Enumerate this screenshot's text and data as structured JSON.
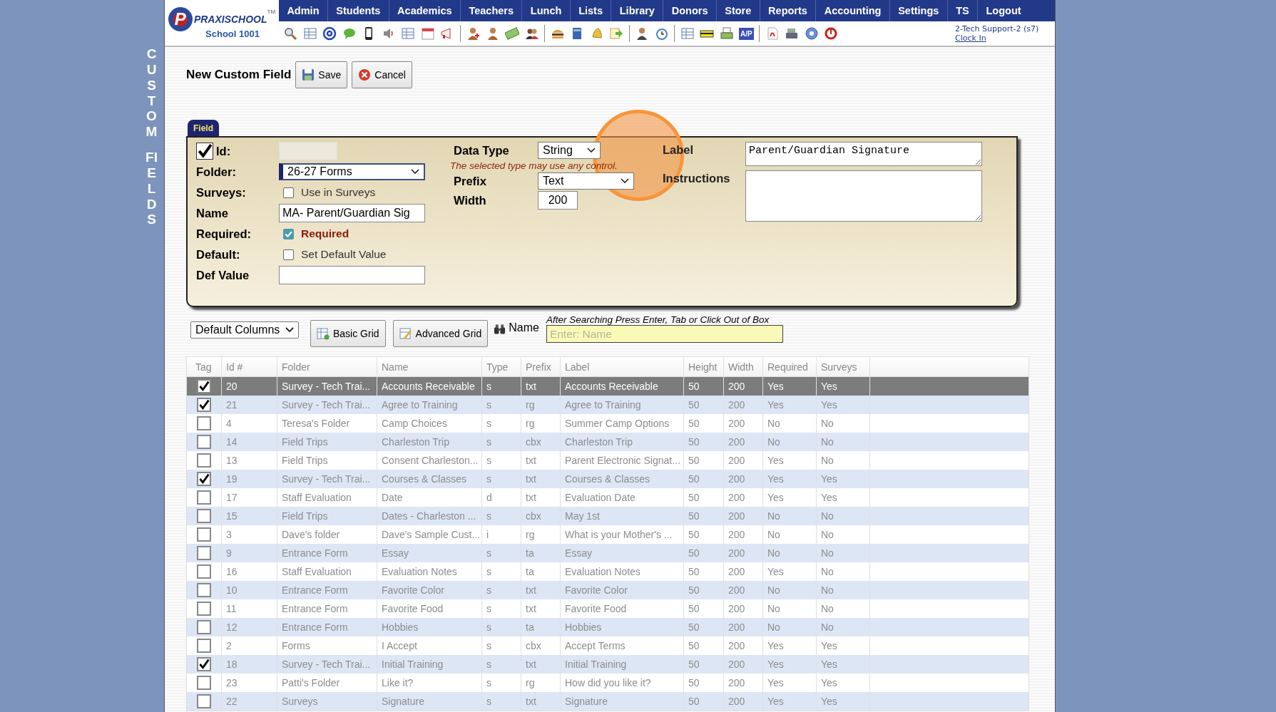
{
  "side_title": [
    "CUSTOM",
    "FIELDS"
  ],
  "logo": {
    "mark": "P",
    "name": "PRAXISCHOOL",
    "tm": "TM",
    "school": "School 1001"
  },
  "nav": [
    "Admin",
    "Students",
    "Academics",
    "Teachers",
    "Lunch",
    "Lists",
    "Library",
    "Donors",
    "Store",
    "Reports",
    "Accounting",
    "Settings",
    "TS",
    "Logout"
  ],
  "toolbar": {
    "ap_badge": "A/P"
  },
  "user": {
    "name": "2-Tech Support-2 (s7)",
    "clock_link": "Clock In"
  },
  "page_title": "New Custom Field",
  "actions": [
    "Save",
    "Cancel"
  ],
  "form": {
    "tab": "Field",
    "id": {
      "label": "Id:",
      "checked": true
    },
    "folder": {
      "label": "Folder:",
      "value": "26-27 Forms"
    },
    "surveys": {
      "label": "Surveys:",
      "option": "Use in Surveys",
      "checked": false
    },
    "name": {
      "label": "Name",
      "value": "MA- Parent/Guardian Sig"
    },
    "required": {
      "label": "Required:",
      "option": "Required",
      "checked": true
    },
    "default": {
      "label": "Default:",
      "option": "Set Default Value",
      "checked": false
    },
    "def_value": {
      "label": "Def Value"
    },
    "data_type": {
      "label": "Data Type",
      "value": "String",
      "hint": "The selected type may use any control."
    },
    "prefix": {
      "label": "Prefix",
      "value": "Text"
    },
    "width": {
      "label": "Width",
      "value": "200"
    },
    "label": {
      "label": "Label",
      "value": "Parent/Guardian Signature"
    },
    "instructions": {
      "label": "Instructions"
    }
  },
  "grid_toolbar": {
    "columns_select": "Default Columns",
    "buttons": [
      "Basic Grid",
      "Advanced Grid"
    ],
    "search_label": "Name",
    "search_hint": "After Searching Press Enter, Tab or Click Out of Box",
    "placeholder": "Enter: Name"
  },
  "table": {
    "tag_column": "Tag",
    "columns": [
      "Id #",
      "Folder",
      "Name",
      "Type",
      "Prefix",
      "Label",
      "Height",
      "Width",
      "Required",
      "Surveys"
    ],
    "rows": [
      {
        "tag": true,
        "selected": true,
        "cells": [
          "20",
          "Survey - Tech Trai...",
          "Accounts Receivable",
          "s",
          "txt",
          "Accounts Receivable",
          "50",
          "200",
          "Yes",
          "Yes"
        ]
      },
      {
        "tag": true,
        "selected": false,
        "cells": [
          "21",
          "Survey - Tech Trai...",
          "Agree to Training",
          "s",
          "rg",
          "Agree to Training",
          "50",
          "200",
          "Yes",
          "Yes"
        ]
      },
      {
        "tag": false,
        "selected": false,
        "cells": [
          "4",
          "Teresa's Folder",
          "Camp Choices",
          "s",
          "rg",
          "Summer Camp Options",
          "50",
          "200",
          "No",
          "No"
        ]
      },
      {
        "tag": false,
        "selected": false,
        "cells": [
          "14",
          "Field Trips",
          "Charleston Trip",
          "s",
          "cbx",
          "Charleston Trip",
          "50",
          "200",
          "No",
          "No"
        ]
      },
      {
        "tag": false,
        "selected": false,
        "cells": [
          "13",
          "Field Trips",
          "Consent Charleston...",
          "s",
          "txt",
          "Parent Electronic Signat...",
          "50",
          "200",
          "Yes",
          "No"
        ]
      },
      {
        "tag": true,
        "selected": false,
        "cells": [
          "19",
          "Survey - Tech Trai...",
          "Courses & Classes",
          "s",
          "txt",
          "Courses & Classes",
          "50",
          "200",
          "Yes",
          "Yes"
        ]
      },
      {
        "tag": false,
        "selected": false,
        "cells": [
          "17",
          "Staff Evaluation",
          "Date",
          "d",
          "txt",
          "Evaluation Date",
          "50",
          "200",
          "Yes",
          "Yes"
        ]
      },
      {
        "tag": false,
        "selected": false,
        "cells": [
          "15",
          "Field Trips",
          "Dates - Charleston ...",
          "s",
          "cbx",
          "May 1st",
          "50",
          "200",
          "No",
          "No"
        ]
      },
      {
        "tag": false,
        "selected": false,
        "cells": [
          "3",
          "Dave's folder",
          "Dave's Sample Cust...",
          "i",
          "rg",
          "What is your Mother's ...",
          "50",
          "200",
          "No",
          "No"
        ]
      },
      {
        "tag": false,
        "selected": false,
        "cells": [
          "9",
          "Entrance Form",
          "Essay",
          "s",
          "ta",
          "Essay",
          "50",
          "200",
          "No",
          "No"
        ]
      },
      {
        "tag": false,
        "selected": false,
        "cells": [
          "16",
          "Staff Evaluation",
          "Evaluation Notes",
          "s",
          "ta",
          "Evaluation Notes",
          "50",
          "200",
          "Yes",
          "No"
        ]
      },
      {
        "tag": false,
        "selected": false,
        "cells": [
          "10",
          "Entrance Form",
          "Favorite Color",
          "s",
          "txt",
          "Favorite Color",
          "50",
          "200",
          "No",
          "No"
        ]
      },
      {
        "tag": false,
        "selected": false,
        "cells": [
          "11",
          "Entrance Form",
          "Favorite Food",
          "s",
          "txt",
          "Favorite Food",
          "50",
          "200",
          "No",
          "No"
        ]
      },
      {
        "tag": false,
        "selected": false,
        "cells": [
          "12",
          "Entrance Form",
          "Hobbies",
          "s",
          "ta",
          "Hobbies",
          "50",
          "200",
          "No",
          "No"
        ]
      },
      {
        "tag": false,
        "selected": false,
        "cells": [
          "2",
          "Forms",
          "I Accept",
          "s",
          "cbx",
          "Accept Terms",
          "50",
          "200",
          "Yes",
          "Yes"
        ]
      },
      {
        "tag": true,
        "selected": false,
        "cells": [
          "18",
          "Survey - Tech Trai...",
          "Initial Training",
          "s",
          "txt",
          "Initial Training",
          "50",
          "200",
          "Yes",
          "Yes"
        ]
      },
      {
        "tag": false,
        "selected": false,
        "cells": [
          "23",
          "Patti's Folder",
          "Like it?",
          "s",
          "rg",
          "How did you like it?",
          "50",
          "200",
          "Yes",
          "Yes"
        ]
      },
      {
        "tag": false,
        "selected": false,
        "cells": [
          "22",
          "Surveys",
          "Signature",
          "s",
          "txt",
          "Signature",
          "50",
          "200",
          "Yes",
          "Yes"
        ]
      }
    ]
  }
}
